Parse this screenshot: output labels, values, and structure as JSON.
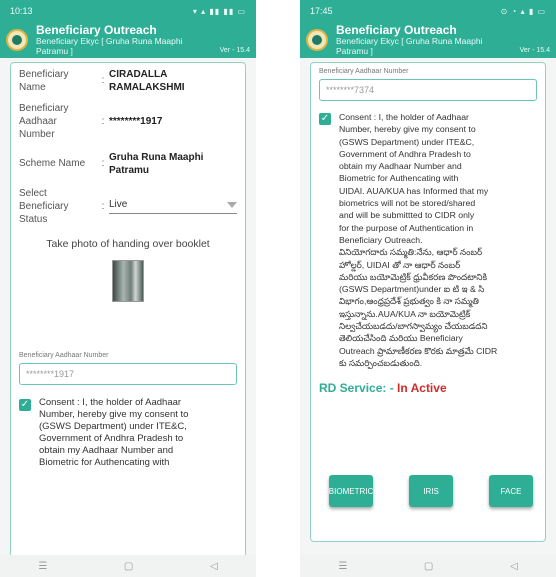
{
  "left": {
    "status_time": "10:13",
    "status_icons": "▾ ▴ ▮▮ ▮▮ ▭",
    "app_title": "Beneficiary Outreach",
    "app_subtitle_1": "Beneficiary Ekyc [ Gruha Runa Maaphi",
    "app_subtitle_2": "Patramu ]",
    "version": "Ver - 15.4",
    "beneficiary_name_label_1": "Beneficiary",
    "beneficiary_name_label_2": "Name",
    "beneficiary_name_1": "CIRADALLA",
    "beneficiary_name_2": "RAMALAKSHMI",
    "aadhaar_label_1": "Beneficiary",
    "aadhaar_label_2": "Aadhaar",
    "aadhaar_label_3": "Number",
    "aadhaar_value": "********1917",
    "scheme_label": "Scheme Name",
    "scheme_value_1": "Gruha Runa Maaphi",
    "scheme_value_2": "Patramu",
    "status_label_1": "Select",
    "status_label_2": "Beneficiary",
    "status_label_3": "Status",
    "status_value": "Live",
    "photo_title": "Take photo of handing over booklet",
    "field_label": "Beneficiary Aadhaar Number",
    "field_value": "********1917",
    "consent_lines": [
      "Consent : I, the holder of Aadhaar",
      "Number, hereby give my consent to",
      "(GSWS Department) under ITE&C,",
      "Government of Andhra Pradesh to",
      "obtain my Aadhaar Number and",
      "Biometric for Authencating with"
    ]
  },
  "right": {
    "status_time": "17:45",
    "status_icons": "⊙ ◔ ▴ ▮ ▭",
    "app_title": "Beneficiary Outreach",
    "app_subtitle_1": "Beneficiary Ekyc [ Gruha Runa Maaphi",
    "app_subtitle_2": "Patramu ]",
    "version": "Ver - 15.4",
    "field_label": "Beneficiary Aadhaar Number",
    "field_value": "********7374",
    "consent_lines": [
      "Consent : I, the holder of Aadhaar",
      "Number, hereby give my consent to",
      "(GSWS Department) under ITE&C,",
      "Government of Andhra Pradesh to",
      "obtain my Aadhaar Number and",
      "Biometric for Authencating with",
      "UIDAI. AUA/KUA has Informed that my",
      "biometrics will not be stored/shared",
      "and will be submittted to CIDR only",
      "for the purpose of Authentication in",
      "Beneficiary Outreach.",
      "వినియోగదారు సమ్మతి:నేను, ఆధార్ నంబర్",
      "హోల్డర్, UIDAI తో నా ఆధార్ నంబర్",
      "మరియు బయోమెట్రిక్ ధ్రువీకరణ పొందటానికి",
      "(GSWS Department)under ఐ టి ఇ & సి",
      "విభాగం,ఆంధ్రప్రదేశ్ ప్రభుత్వం కి నా సమ్మతి",
      "ఇస్తున్నాను.AUA/KUA నా బయోమెట్రిక్",
      "నిల్వచేయబడదు/బాగస్వామ్యం చేయబడదని",
      "తెలియచేసింది మరియు Beneficiary",
      "Outreach ప్రామాణీకరణ కొరకు మాత్రమే CIDR",
      "కు సమర్పించబడుతుంది."
    ],
    "rd_label": "RD Service: -",
    "rd_status": "In Active",
    "btn_biometric": "BIOMETRIC",
    "btn_iris": "IRIS",
    "btn_face": "FACE"
  },
  "colors": {
    "accent": "#2fae96",
    "inactive": "#cf2b2b"
  }
}
